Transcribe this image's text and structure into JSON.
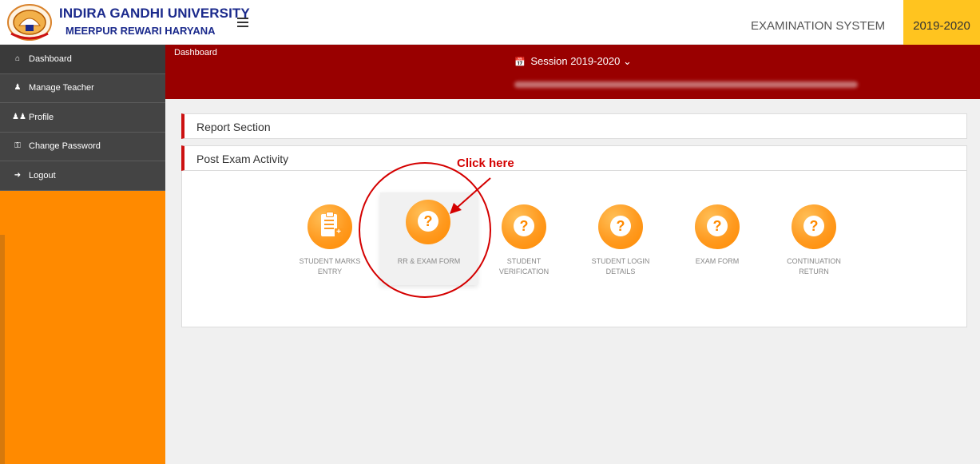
{
  "header": {
    "university_name": "INDIRA GANDHI UNIVERSITY",
    "university_location": "MEERPUR REWARI HARYANA",
    "system_title": "EXAMINATION SYSTEM",
    "year_badge": "2019-2020"
  },
  "sidebar": {
    "items": [
      {
        "label": "Dashboard",
        "icon": "home-icon"
      },
      {
        "label": "Manage Teacher",
        "icon": "user-plus-icon"
      },
      {
        "label": "Profile",
        "icon": "users-icon"
      },
      {
        "label": "Change Password",
        "icon": "key-icon"
      },
      {
        "label": "Logout",
        "icon": "sign-out-icon"
      }
    ]
  },
  "band": {
    "breadcrumb": "Dashboard",
    "session_label": "Session  2019-2020",
    "session_caret": "⌄"
  },
  "sections": {
    "report": "Report Section",
    "post_exam": "Post Exam Activity"
  },
  "tiles": [
    {
      "label": "STUDENT MARKS ENTRY",
      "icon": "clipboard-plus-icon"
    },
    {
      "label": "RR & EXAM FORM",
      "icon": "question-bubble-icon"
    },
    {
      "label": "STUDENT VERIFICATION",
      "icon": "question-bubble-icon"
    },
    {
      "label": "STUDENT LOGIN DETAILS",
      "icon": "question-bubble-icon"
    },
    {
      "label": "EXAM FORM",
      "icon": "question-bubble-icon"
    },
    {
      "label": "CONTINUATION RETURN",
      "icon": "question-bubble-icon"
    }
  ],
  "annotation": {
    "text": "Click here",
    "color": "#d40000"
  },
  "colors": {
    "accent_orange": "#ff8a00",
    "band_crimson": "#990000",
    "brand_blue": "#1b2a8c",
    "year_yellow": "#ffc41f"
  }
}
